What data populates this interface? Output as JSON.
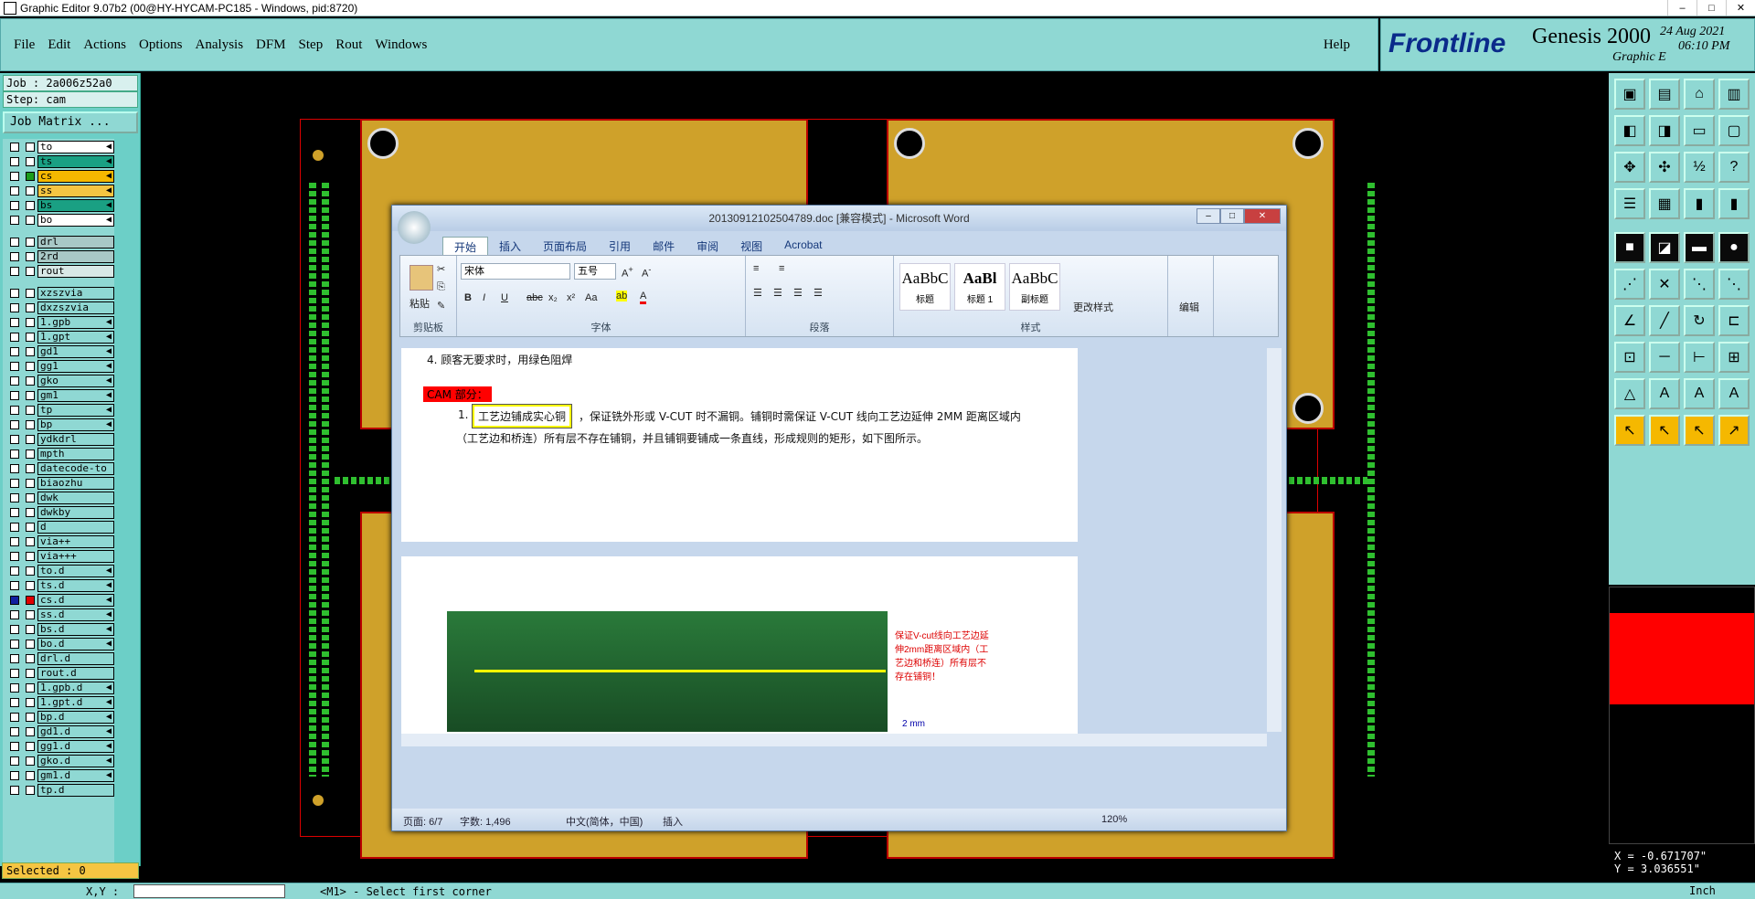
{
  "titlebar": {
    "title": "Graphic Editor 9.07b2 (00@HY-HYCAM-PC185 - Windows, pid:8720)"
  },
  "menu": {
    "items": [
      "File",
      "Edit",
      "Actions",
      "Options",
      "Analysis",
      "DFM",
      "Step",
      "Rout",
      "Windows"
    ],
    "help": "Help"
  },
  "brand": {
    "logo": "Frontline",
    "product": "Genesis 2000",
    "date": "24 Aug 2021",
    "time": "06:10 PM",
    "sub": "Graphic E"
  },
  "job": {
    "job_label": "Job : 2a006z52a0",
    "step_label": "Step: cam",
    "matrix_button": "Job Matrix ..."
  },
  "layers": [
    {
      "name": "to",
      "color": "#ffffff",
      "arrow": "◀"
    },
    {
      "name": "ts",
      "color": "#1aa083",
      "arrow": "◀"
    },
    {
      "name": "cs",
      "color": "#f5b800",
      "arrow": "◀",
      "mark": "#1a9c1a"
    },
    {
      "name": "ss",
      "color": "#f5c542",
      "arrow": "◀"
    },
    {
      "name": "bs",
      "color": "#1aa083",
      "arrow": "◀"
    },
    {
      "name": "bo",
      "color": "#ffffff",
      "arrow": "◀"
    },
    {
      "name": "drl",
      "color": "#a8c8c6",
      "arrow": ""
    },
    {
      "name": "2rd",
      "color": "#a8c8c6",
      "arrow": ""
    },
    {
      "name": "rout",
      "color": "#d8e8e6",
      "arrow": ""
    },
    {
      "name": "xzszvia",
      "color": "#8fd8d3",
      "arrow": ""
    },
    {
      "name": "dxzszvia",
      "color": "#8fd8d3",
      "arrow": ""
    },
    {
      "name": "1.gpb",
      "color": "#8fd8d3",
      "arrow": "◀"
    },
    {
      "name": "1.gpt",
      "color": "#8fd8d3",
      "arrow": "◀"
    },
    {
      "name": "gd1",
      "color": "#8fd8d3",
      "arrow": "◀"
    },
    {
      "name": "gg1",
      "color": "#8fd8d3",
      "arrow": "◀"
    },
    {
      "name": "gko",
      "color": "#8fd8d3",
      "arrow": "◀"
    },
    {
      "name": "gm1",
      "color": "#8fd8d3",
      "arrow": "◀"
    },
    {
      "name": "tp",
      "color": "#8fd8d3",
      "arrow": "◀"
    },
    {
      "name": "bp",
      "color": "#8fd8d3",
      "arrow": "◀"
    },
    {
      "name": "ydkdrl",
      "color": "#8fd8d3",
      "arrow": ""
    },
    {
      "name": "mpth",
      "color": "#8fd8d3",
      "arrow": ""
    },
    {
      "name": "datecode-to",
      "color": "#8fd8d3",
      "arrow": ""
    },
    {
      "name": "biaozhu",
      "color": "#8fd8d3",
      "arrow": ""
    },
    {
      "name": "dwk",
      "color": "#8fd8d3",
      "arrow": ""
    },
    {
      "name": "dwkby",
      "color": "#8fd8d3",
      "arrow": ""
    },
    {
      "name": "d",
      "color": "#8fd8d3",
      "arrow": ""
    },
    {
      "name": "via++",
      "color": "#8fd8d3",
      "arrow": ""
    },
    {
      "name": "via+++",
      "color": "#8fd8d3",
      "arrow": ""
    },
    {
      "name": "to.d",
      "color": "#8fd8d3",
      "arrow": "◀"
    },
    {
      "name": "ts.d",
      "color": "#8fd8d3",
      "arrow": "◀"
    },
    {
      "name": "cs.d",
      "color": "#8fd8d3",
      "arrow": "◀",
      "mark": "#e00000",
      "mark1": "#1020a0"
    },
    {
      "name": "ss.d",
      "color": "#8fd8d3",
      "arrow": "◀"
    },
    {
      "name": "bs.d",
      "color": "#8fd8d3",
      "arrow": "◀"
    },
    {
      "name": "bo.d",
      "color": "#8fd8d3",
      "arrow": "◀"
    },
    {
      "name": "drl.d",
      "color": "#8fd8d3",
      "arrow": ""
    },
    {
      "name": "rout.d",
      "color": "#8fd8d3",
      "arrow": ""
    },
    {
      "name": "1.gpb.d",
      "color": "#8fd8d3",
      "arrow": "◀"
    },
    {
      "name": "1.gpt.d",
      "color": "#8fd8d3",
      "arrow": "◀"
    },
    {
      "name": "bp.d",
      "color": "#8fd8d3",
      "arrow": "◀"
    },
    {
      "name": "gd1.d",
      "color": "#8fd8d3",
      "arrow": "◀"
    },
    {
      "name": "gg1.d",
      "color": "#8fd8d3",
      "arrow": "◀"
    },
    {
      "name": "gko.d",
      "color": "#8fd8d3",
      "arrow": "◀"
    },
    {
      "name": "gm1.d",
      "color": "#8fd8d3",
      "arrow": "◀"
    },
    {
      "name": "tp.d",
      "color": "#8fd8d3",
      "arrow": ""
    }
  ],
  "selected": "Selected : 0",
  "coords": {
    "x": "X = -0.671707\"",
    "y": "Y = 3.036551\""
  },
  "bottombar": {
    "prompt": "<M1> - Select first corner",
    "xy_label": "X,Y :",
    "units": "Inch"
  },
  "word": {
    "title": "20130912102504789.doc [兼容模式] - Microsoft Word",
    "tabs": [
      "开始",
      "插入",
      "页面布局",
      "引用",
      "邮件",
      "审阅",
      "视图",
      "Acrobat"
    ],
    "font_name": "宋体",
    "font_size": "五号",
    "groups": {
      "clipboard": "剪贴板",
      "font": "字体",
      "paragraph": "段落",
      "styles": "样式",
      "paste": "粘贴",
      "change_style": "更改样式",
      "edit": "编辑"
    },
    "styles": [
      {
        "preview": "AaBbC",
        "name": "标题"
      },
      {
        "preview": "AaBl",
        "name": "标题 1"
      },
      {
        "preview": "AaBbC",
        "name": "副标题"
      }
    ],
    "line1": "4.   顾客无要求时，用绿色阻焊",
    "cam_heading": "CAM 部分：",
    "item_num": "1.",
    "item_highlight": "工艺边铺成实心铜",
    "item_rest": "，保证铣外形或 V-CUT 时不漏铜。铺铜时需保证 V-CUT 线向工艺边延伸 2MM 距离区域内",
    "item_line2": "（工艺边和桥连）所有层不存在铺铜，并且铺铜要铺成一条直线，形成规则的矩形，如下图所示。",
    "note": [
      "保证V-cut线向工艺边延",
      "伸2mm距离区域内（工",
      "艺边和桥连）所有层不",
      "存在铺铜！"
    ],
    "note_dim": "2 mm",
    "status": {
      "page": "页面: 6/7",
      "words": "字数: 1,496",
      "lang": "中文(简体，中国)",
      "mode": "插入",
      "zoom": "120%"
    }
  }
}
